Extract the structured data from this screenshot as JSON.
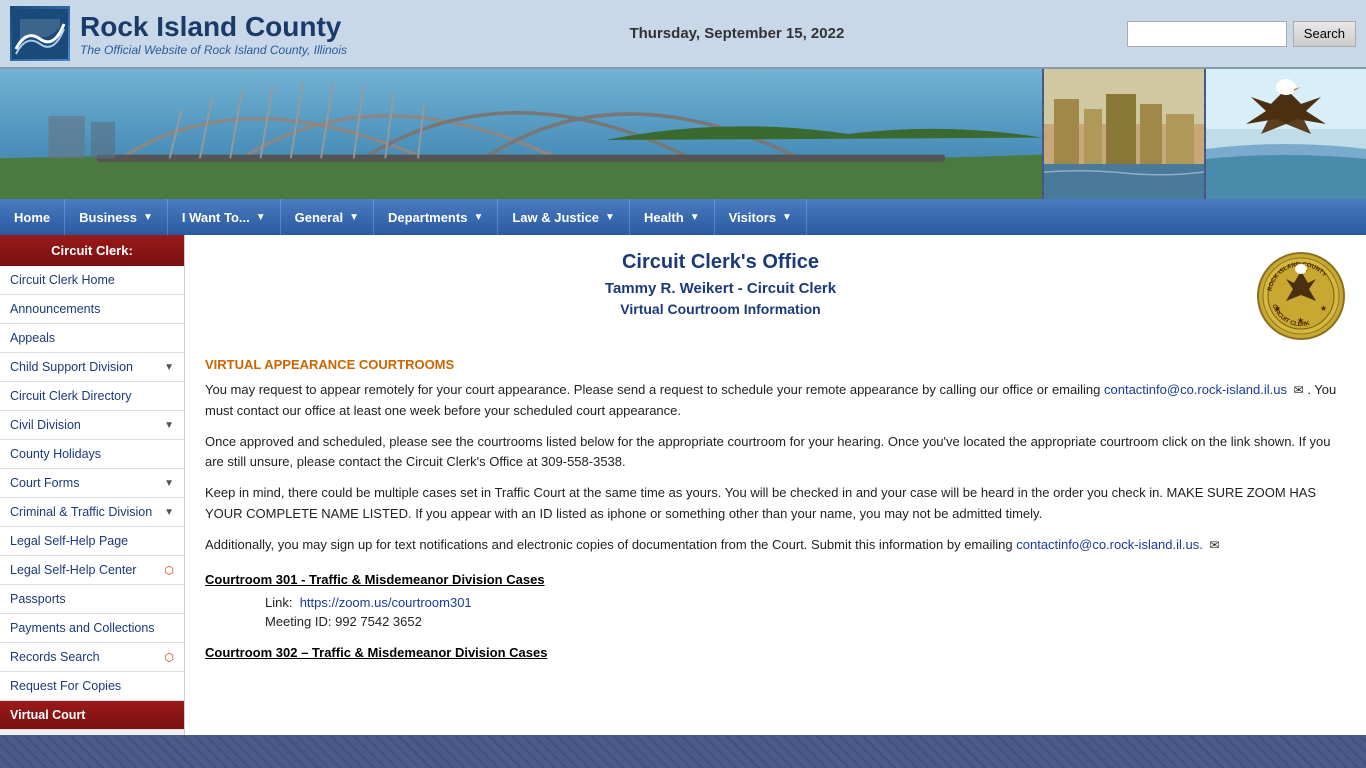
{
  "header": {
    "logo_title": "Rock Island County",
    "logo_subtitle": "The Official Website of Rock Island County, Illinois",
    "date": "Thursday, September 15, 2022",
    "search_placeholder": "",
    "search_button": "Search"
  },
  "navbar": {
    "items": [
      {
        "label": "Home",
        "has_arrow": false
      },
      {
        "label": "Business",
        "has_arrow": true
      },
      {
        "label": "I Want To...",
        "has_arrow": true
      },
      {
        "label": "General",
        "has_arrow": true
      },
      {
        "label": "Departments",
        "has_arrow": true
      },
      {
        "label": "Law & Justice",
        "has_arrow": true
      },
      {
        "label": "Health",
        "has_arrow": true
      },
      {
        "label": "Visitors",
        "has_arrow": true
      }
    ]
  },
  "sidebar": {
    "title": "Circuit Clerk:",
    "items": [
      {
        "label": "Circuit Clerk Home",
        "active": false,
        "has_arrow": false,
        "has_external": false
      },
      {
        "label": "Announcements",
        "active": false,
        "has_arrow": false,
        "has_external": false
      },
      {
        "label": "Appeals",
        "active": false,
        "has_arrow": false,
        "has_external": false
      },
      {
        "label": "Child Support Division",
        "active": false,
        "has_arrow": true,
        "has_external": false
      },
      {
        "label": "Circuit Clerk Directory",
        "active": false,
        "has_arrow": false,
        "has_external": false
      },
      {
        "label": "Civil Division",
        "active": false,
        "has_arrow": true,
        "has_external": false
      },
      {
        "label": "County Holidays",
        "active": false,
        "has_arrow": false,
        "has_external": false
      },
      {
        "label": "Court Forms",
        "active": false,
        "has_arrow": true,
        "has_external": false
      },
      {
        "label": "Criminal & Traffic Division",
        "active": false,
        "has_arrow": true,
        "has_external": false
      },
      {
        "label": "Legal Self-Help Page",
        "active": false,
        "has_arrow": false,
        "has_external": false
      },
      {
        "label": "Legal Self-Help Center",
        "active": false,
        "has_arrow": false,
        "has_external": true
      },
      {
        "label": "Passports",
        "active": false,
        "has_arrow": false,
        "has_external": false
      },
      {
        "label": "Payments and Collections",
        "active": false,
        "has_arrow": false,
        "has_external": false
      },
      {
        "label": "Records Search",
        "active": false,
        "has_arrow": false,
        "has_external": true
      },
      {
        "label": "Request For Copies",
        "active": false,
        "has_arrow": false,
        "has_external": false
      },
      {
        "label": "Virtual Court",
        "active": true,
        "has_arrow": false,
        "has_external": false
      }
    ]
  },
  "content": {
    "title": "Circuit Clerk's Office",
    "subtitle": "Tammy R. Weikert - Circuit Clerk",
    "page_title": "Virtual Courtroom Information",
    "section_heading": "VIRTUAL APPEARANCE COURTROOMS",
    "para1": "You may request to appear remotely for your court appearance. Please send a request to schedule your remote appearance by calling our office or emailing",
    "email1": "contactinfo@co.rock-island.il.us",
    "para1b": ". You must contact our office at least one week before your scheduled court appearance.",
    "para2": "Once approved and scheduled, please see the courtrooms listed below for the appropriate courtroom for your hearing. Once you've located the appropriate courtroom click on the link shown. If you are still unsure, please contact the Circuit Clerk's Office at 309-558-3538.",
    "para3": "Keep in mind, there could be multiple cases set in Traffic Court at the same time as yours. You will be checked in and your case will be heard in the order you check in. MAKE SURE ZOOM HAS YOUR COMPLETE NAME LISTED. If you appear with an ID listed as iphone or something other than your name, you may not be admitted timely.",
    "para4a": "Additionally, you may sign up for text notifications and electronic copies of documentation from the Court. Submit this information by emailing",
    "email2": "contactinfo@co.rock-island.il.us.",
    "courtroom1_label": "Courtroom 301",
    "courtroom1_dash": " - Traffic & Misdemeanor Division Cases",
    "courtroom1_link_label": "Link:  https://zoom.us/courtroom301",
    "courtroom1_link_url": "https://zoom.us/courtroom301",
    "courtroom1_meeting": "Meeting ID: 992 7542 3652",
    "courtroom2_label": "Courtroom 302 – Traffic & Misdemeanor Division Cases"
  }
}
